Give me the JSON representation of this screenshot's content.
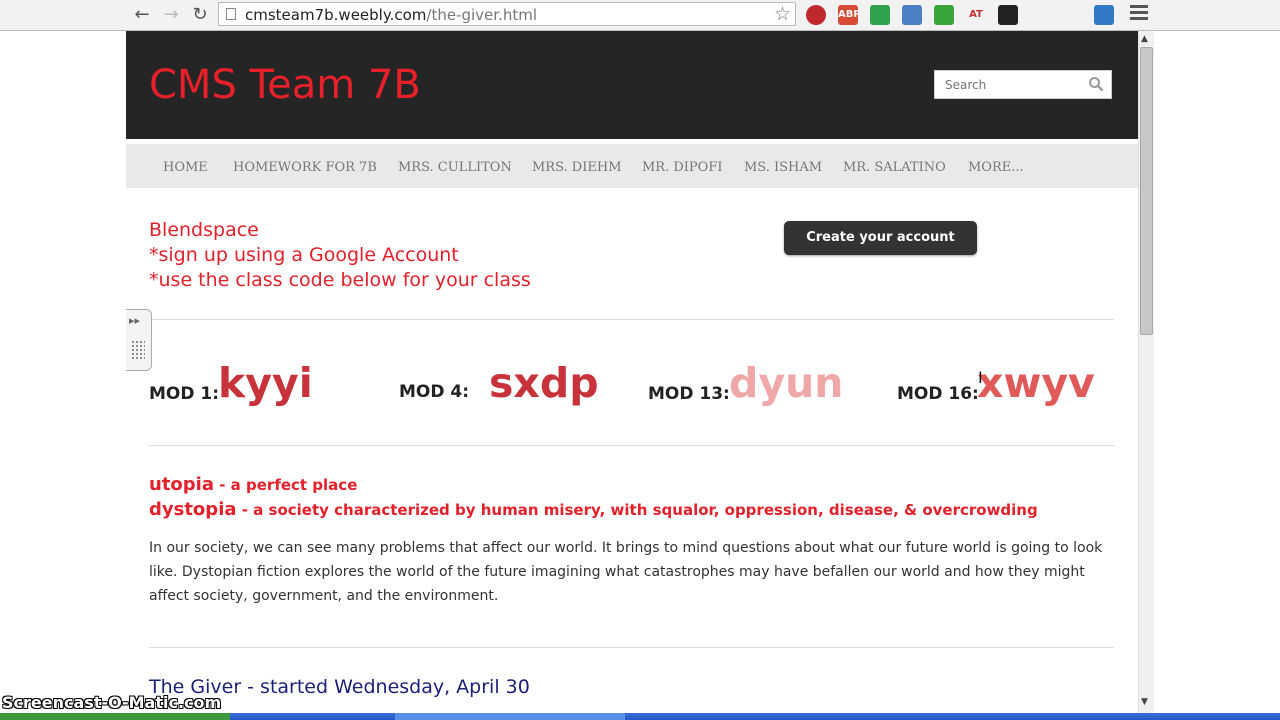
{
  "browser": {
    "url_host": "cmsteam7b.weebly.com",
    "url_path": "/the-giver.html",
    "extensions": [
      {
        "name": "stop-extension-icon",
        "label": "",
        "color": "#c0282e"
      },
      {
        "name": "adblock-plus-icon",
        "label": "ABP",
        "color": "#d64a36"
      },
      {
        "name": "google-drive-icon",
        "label": "",
        "color": "#2fa24c"
      },
      {
        "name": "audio-extension-icon",
        "label": "",
        "color": "#4d7fc4"
      },
      {
        "name": "sound-extension-icon",
        "label": "",
        "color": "#3aa63a"
      },
      {
        "name": "at-extension-icon",
        "label": "AT",
        "color": "#ffffff"
      },
      {
        "name": "terminal-extension-icon",
        "label": "",
        "color": "#222222"
      },
      {
        "name": "tldr-extension-icon",
        "label": "",
        "color": "#ffffff"
      },
      {
        "name": "tools-extension-icon",
        "label": "",
        "color": "#ffffff"
      },
      {
        "name": "screen-extension-icon",
        "label": "",
        "color": "#2f79c6"
      }
    ]
  },
  "site": {
    "title": "CMS Team 7B",
    "search_placeholder": "Search",
    "nav": [
      "HOME",
      "HOMEWORK FOR 7B",
      "MRS. CULLITON",
      "MRS. DIEHM",
      "MR. DIPOFI",
      "MS. ISHAM",
      "MR. SALATINO",
      "MORE..."
    ]
  },
  "blendspace": {
    "lines": [
      "Blendspace",
      "*sign up using a Google Account",
      "*use the class code below for your class"
    ],
    "create_button": "Create your account"
  },
  "mods": [
    {
      "label": "MOD 1:",
      "code": "kyyi",
      "color": "#c8323a"
    },
    {
      "label": "MOD 4:",
      "code": "sxdp",
      "color": "#c8323a"
    },
    {
      "label": "MOD 13:",
      "code": "dyun",
      "color": "#f0a7a7"
    },
    {
      "label": "MOD 16:",
      "code": "xwyv",
      "color": "#e05a5a"
    }
  ],
  "definitions": [
    {
      "term": "utopia",
      "desc": " - a perfect place"
    },
    {
      "term": "dystopia",
      "desc": " - a society characterized by human misery, with squalor, oppression, disease, & overcrowding"
    }
  ],
  "paragraph": "In our society, we can see many problems that affect our world.  It brings to mind questions about what our future world is going to look like.  Dystopian fiction explores the world of the future imagining what catastrophes may have befallen our world and how they might affect society, government, and the environment.",
  "giver_heading": "The Giver - started Wednesday, April 30",
  "watermark": "Screencast-O-Matic.com"
}
